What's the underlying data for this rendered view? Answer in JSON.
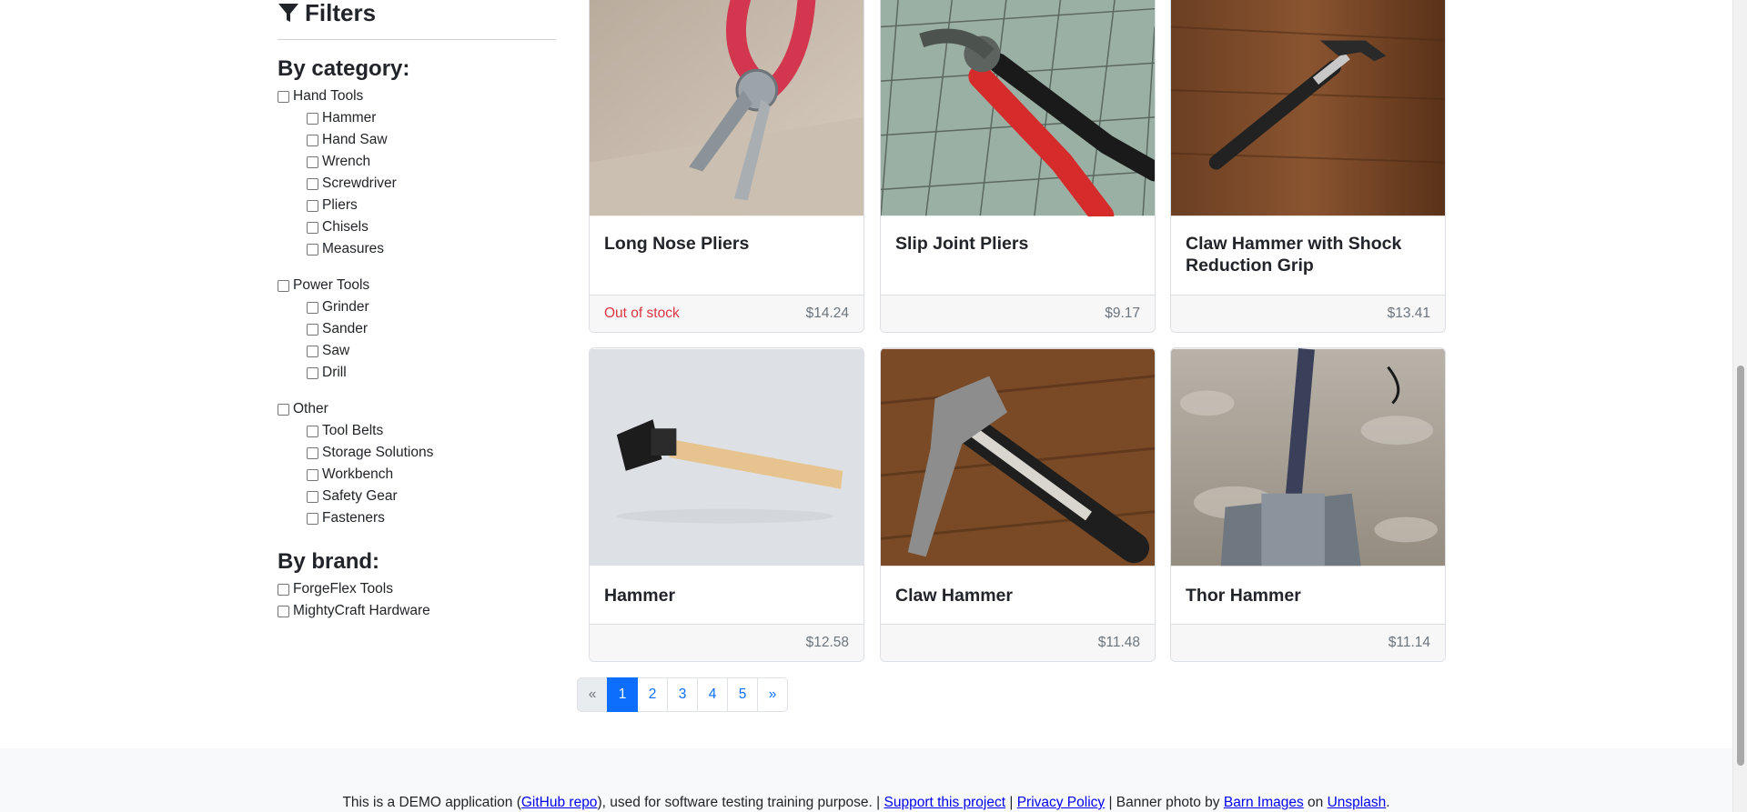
{
  "filters": {
    "title": "Filters",
    "category_title": "By category:",
    "categories": [
      {
        "label": "Hand Tools",
        "children": [
          "Hammer",
          "Hand Saw",
          "Wrench",
          "Screwdriver",
          "Pliers",
          "Chisels",
          "Measures"
        ]
      },
      {
        "label": "Power Tools",
        "children": [
          "Grinder",
          "Sander",
          "Saw",
          "Drill"
        ]
      },
      {
        "label": "Other",
        "children": [
          "Tool Belts",
          "Storage Solutions",
          "Workbench",
          "Safety Gear",
          "Fasteners"
        ]
      }
    ],
    "brand_title": "By brand:",
    "brands": [
      "ForgeFlex Tools",
      "MightyCraft Hardware"
    ]
  },
  "products": [
    {
      "name": "Long Nose Pliers",
      "price": "$14.24",
      "status": "Out of stock"
    },
    {
      "name": "Slip Joint Pliers",
      "price": "$9.17",
      "status": ""
    },
    {
      "name": "Claw Hammer with Shock Reduction Grip",
      "price": "$13.41",
      "status": ""
    },
    {
      "name": "Hammer",
      "price": "$12.58",
      "status": ""
    },
    {
      "name": "Claw Hammer",
      "price": "$11.48",
      "status": ""
    },
    {
      "name": "Thor Hammer",
      "price": "$11.14",
      "status": ""
    }
  ],
  "pagination": {
    "prev": "«",
    "pages": [
      "1",
      "2",
      "3",
      "4",
      "5"
    ],
    "active": "1",
    "next": "»"
  },
  "footer": {
    "part1": "This is a DEMO application (",
    "github_link": "GitHub repo",
    "part2": "), used for software testing training purpose. | ",
    "support_link": "Support this project",
    "sep1": " | ",
    "privacy_link": "Privacy Policy",
    "part3": " | Banner photo by ",
    "barn_link": "Barn Images",
    "part4": " on ",
    "unsplash_link": "Unsplash",
    "part5": "."
  }
}
